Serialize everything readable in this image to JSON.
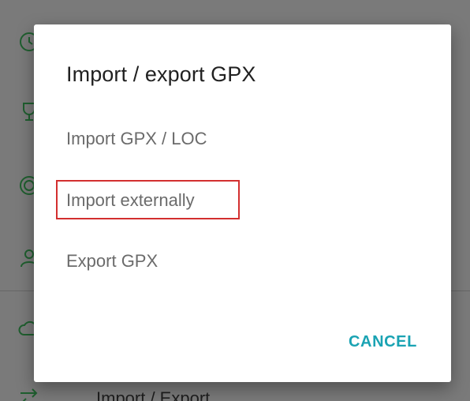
{
  "background": {
    "list_label": "Import / Export",
    "icons": [
      "clock-icon",
      "trophy-icon",
      "target-icon",
      "user-icon",
      "cloud-sync-icon",
      "import-export-icon"
    ]
  },
  "dialog": {
    "title": "Import / export GPX",
    "items": [
      {
        "label": "Import GPX / LOC"
      },
      {
        "label": "Import externally"
      },
      {
        "label": "Export GPX"
      }
    ],
    "cancel_label": "CANCEL"
  },
  "colors": {
    "accent": "#1aa3b3",
    "highlight": "#d32f2f",
    "scrim": "#7a7a7a"
  }
}
